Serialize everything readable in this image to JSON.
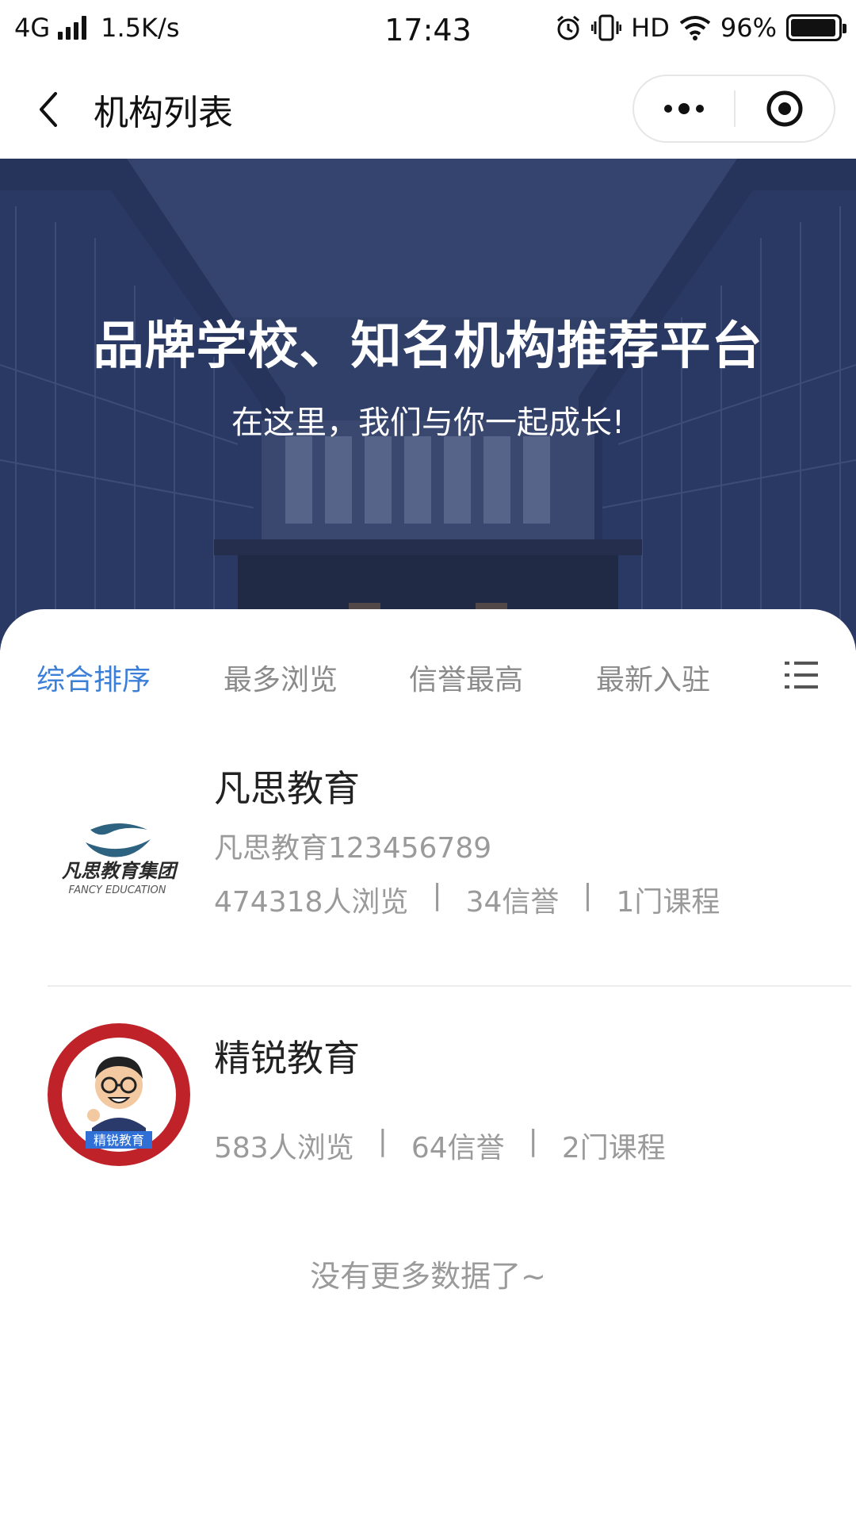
{
  "status_bar": {
    "network": "4G",
    "speed": "1.5K/s",
    "time": "17:43",
    "hd": "HD",
    "battery": "96%",
    "battery_level": 0.96
  },
  "nav": {
    "title": "机构列表"
  },
  "banner": {
    "title": "品牌学校、知名机构推荐平台",
    "subtitle": "在这里，我们与你一起成长!"
  },
  "tabs": [
    {
      "label": "综合排序",
      "active": true
    },
    {
      "label": "最多浏览",
      "active": false
    },
    {
      "label": "信誉最高",
      "active": false
    },
    {
      "label": "最新入驻",
      "active": false
    }
  ],
  "orgs": [
    {
      "name": "凡思教育",
      "desc": "凡思教育123456789",
      "views": "474318人浏览",
      "credit": "34信誉",
      "courses": "1门课程",
      "logo_text": "凡思教育集团",
      "logo_sub": "FANCY EDUCATION"
    },
    {
      "name": "精锐教育",
      "desc": "",
      "views": "583人浏览",
      "credit": "64信誉",
      "courses": "2门课程",
      "logo_text": "精锐教育"
    }
  ],
  "separator": "|",
  "footer": {
    "no_more": "没有更多数据了~"
  },
  "colors": {
    "accent": "#3b7fd8",
    "muted_text": "#9a9a9a",
    "banner": "#3a4b78"
  }
}
